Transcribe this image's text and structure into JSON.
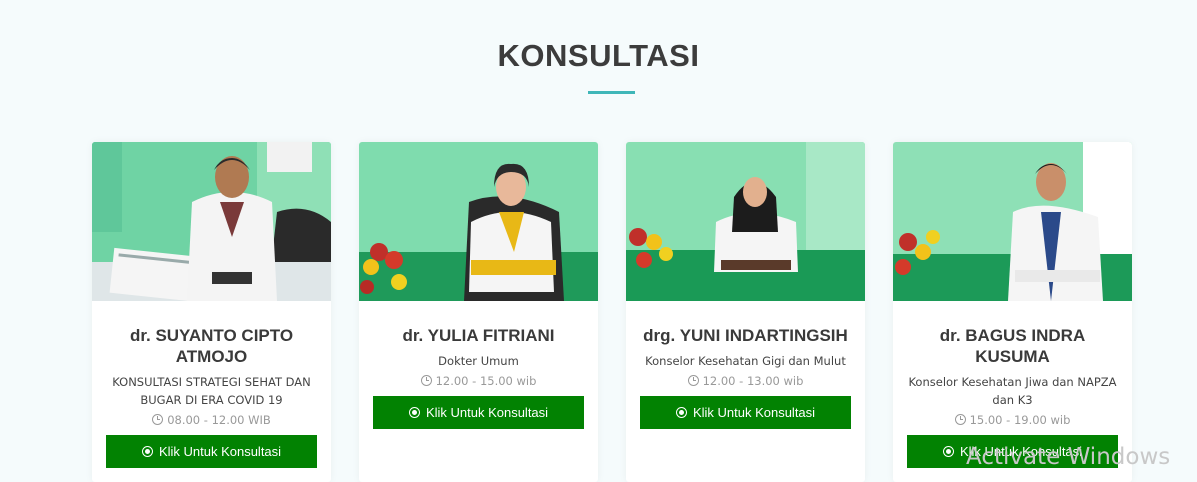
{
  "section": {
    "title": "KONSULTASI"
  },
  "doctors": [
    {
      "name": "dr. SUYANTO CIPTO ATMOJO",
      "specialty": "KONSULTASI STRATEGI SEHAT DAN BUGAR DI ERA COVID 19",
      "time": "08.00 - 12.00 WIB",
      "button": "Klik Untuk Konsultasi"
    },
    {
      "name": "dr. YULIA FITRIANI",
      "specialty": "Dokter Umum",
      "time": "12.00 - 15.00 wib",
      "button": "Klik Untuk Konsultasi"
    },
    {
      "name": "drg. YUNI INDARTINGSIH",
      "specialty": "Konselor Kesehatan Gigi dan Mulut",
      "time": "12.00 - 13.00 wib",
      "button": "Klik Untuk Konsultasi"
    },
    {
      "name": "dr. BAGUS INDRA KUSUMA",
      "specialty": "Konselor Kesehatan Jiwa dan NAPZA dan K3",
      "time": "15.00 - 19.00 wib",
      "button": "Klik Untuk Konsultasi"
    }
  ],
  "icons": {
    "time": "clock-icon",
    "button": "whatsapp-icon"
  },
  "colors": {
    "accent": "#3fb6b8",
    "button": "#028202"
  },
  "watermark": "Activate Windows"
}
